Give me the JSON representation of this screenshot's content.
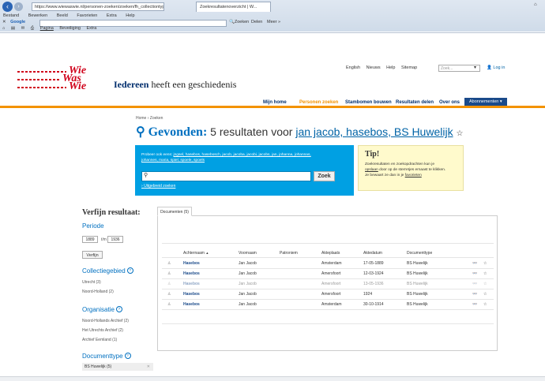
{
  "browser": {
    "url": "https://www.wiewaswie.nl/personen-zoeken/zoeken/fh_collectiontype",
    "tab_title": "Zoekresultatenoverzicht | W...",
    "menu": [
      "Bestand",
      "Bewerken",
      "Beeld",
      "Favorieten",
      "Extra",
      "Help"
    ],
    "google_label": "Google",
    "toolbar2": [
      "Zoeken",
      "Delen",
      "Meer"
    ],
    "toolbar3": [
      "Pagina",
      "Beveiliging",
      "Extra"
    ]
  },
  "site": {
    "logo_top": "Wie",
    "logo_mid": "Was",
    "logo_bot": "Wie",
    "tagline_bold": "Iedereen",
    "tagline_rest": " heeft een geschiedenis",
    "top_links": [
      "English",
      "Nieuws",
      "Help",
      "Sitemap"
    ],
    "search_placeholder": "Zoek...",
    "login": "Log in",
    "nav": [
      "Mijn home",
      "Personen zoeken",
      "Stambomen bouwen",
      "Resultaten delen",
      "Over ons"
    ],
    "nav_active": "Personen zoeken",
    "abonnementen": "Abonnementen"
  },
  "breadcrumb": "Home  ›  Zoeken",
  "headline": {
    "found": "Gevonden:",
    "count_text": " 5 resultaten voor ",
    "query": "jan jacob, hasebos, BS Huwelijk",
    "star": "☆"
  },
  "suggest": {
    "intro": "Probeer ook eens: ",
    "line1": "jngsel, hasebos, hasebosch, jacob, jacoba, jacobi, jacobs, jan, johanna, johannas,",
    "line2": "johannes, maria, spiel, spoele, spoels",
    "search_button": "Zoek",
    "advanced": "Uitgebreid zoeken"
  },
  "tip": {
    "title": "Tip!",
    "line1": "Zoekresultaten en zoekopdrachten kun je",
    "line2_link": "opslaan",
    "line2_rest": " door op de sterretjes ernaast te klikken.",
    "line3": "Je bewaart ze dan in je ",
    "line3_link": "favorieten"
  },
  "sidebar": {
    "title": "Verfijn resultaat:",
    "periode": "Periode",
    "year_from": "1889",
    "year_sep": "t/m",
    "year_to": "1936",
    "refine_button": "Verfijn",
    "collectiegebied": "Collectiegebied",
    "coll_items": [
      "Utrecht (3)",
      "Noord-Holland (2)"
    ],
    "organisatie": "Organisatie",
    "org_items": [
      "Noord-Hollands Archief (2)",
      "Het Utrechts Archief (2)",
      "Archief Eemland (1)"
    ],
    "documenttype": "Documenttype",
    "doc_selected": "BS Huwelijk (5)",
    "remove": "✕"
  },
  "results": {
    "tab_label": "Documenten (5)",
    "columns": [
      "Achternaam",
      "Voornaam",
      "Patroniem",
      "Akteplaats",
      "Aktedatum",
      "Documenttype"
    ],
    "sort_indicator": "▲",
    "rows": [
      {
        "achternaam": "Hasebos",
        "voornaam": "Jan Jacob",
        "patroniem": "",
        "plaats": "Amsterdam",
        "datum": "17-05-1889",
        "type": "BS Huwelijk"
      },
      {
        "achternaam": "Hasebos",
        "voornaam": "Jan Jacob",
        "patroniem": "",
        "plaats": "Amersfoort",
        "datum": "12-03-1924",
        "type": "BS Huwelijk"
      },
      {
        "achternaam": "Hasebos",
        "voornaam": "Jan Jacob",
        "patroniem": "",
        "plaats": "Amersfoort",
        "datum": "13-05-1936",
        "type": "BS Huwelijk"
      },
      {
        "achternaam": "Hasebos",
        "voornaam": "Jan Jacob",
        "patroniem": "",
        "plaats": "Amersfoort",
        "datum": "1924",
        "type": "BS Huwelijk"
      },
      {
        "achternaam": "Hasebos",
        "voornaam": "Jan Jacob",
        "patroniem": "",
        "plaats": "Amsterdam",
        "datum": "30-10-1914",
        "type": "BS Huwelijk"
      }
    ]
  }
}
